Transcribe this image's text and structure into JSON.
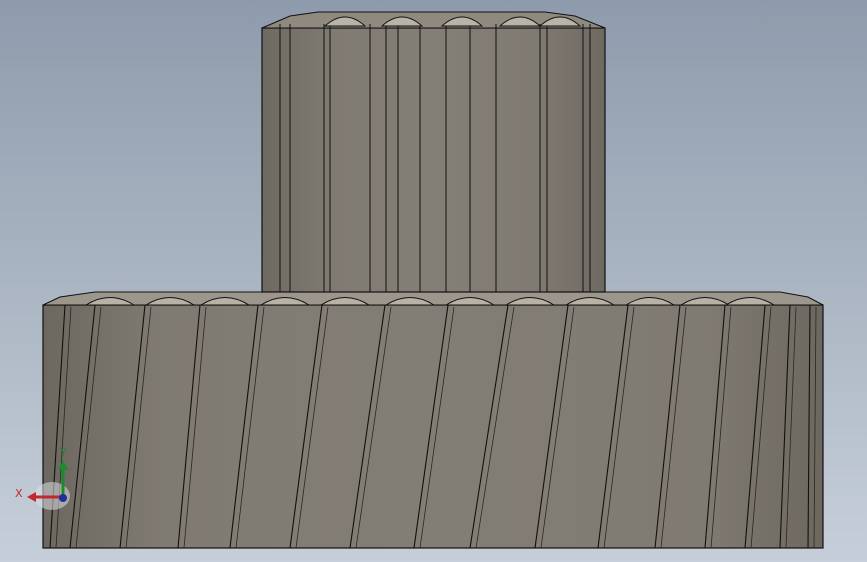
{
  "viewport": {
    "background_top": "#8e9bac",
    "background_bottom": "#c6cfd9"
  },
  "model": {
    "name": "helical-gear-with-pinion",
    "upper_gear": {
      "face_color": "#7e7870",
      "edge_color": "#111111",
      "top_color": "#b7b1a5"
    },
    "lower_gear": {
      "face_color": "#7d7770",
      "edge_color": "#111111",
      "top_color": "#b4ae a3"
    }
  },
  "triad": {
    "x_label": "X",
    "y_label": "Y",
    "x_color": "#c1272d",
    "y_color": "#1e8a2e",
    "z_color": "#1f2f9a"
  }
}
